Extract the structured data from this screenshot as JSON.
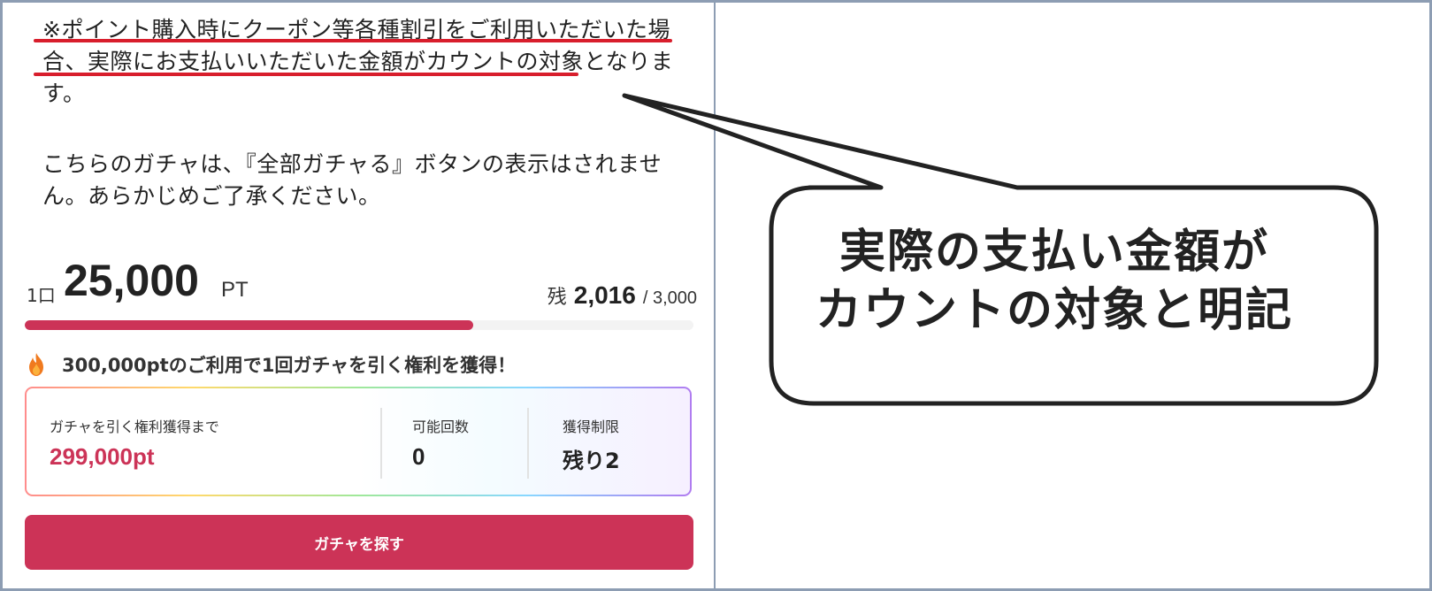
{
  "notice": {
    "line1": "※ポイント購入時にクーポン等各種割引をご利用いただいた場",
    "line2": "合、実際にお支払いいただいた金額がカウントの対象となりま",
    "line3": "す。",
    "line4": "こちらのガチャは、『全部ガチャる』ボタンの表示はされませ",
    "line5": "ん。あらかじめご了承ください。"
  },
  "price": {
    "unit_label": "1口",
    "amount": "25,000",
    "currency": "PT"
  },
  "remaining": {
    "label": "残",
    "count": "2,016",
    "total": "/ 3,000",
    "progress_fraction": 0.67
  },
  "right_banner": {
    "icon": "flame-icon",
    "text": "300,000ptのご利用で1回ガチャを引く権利を獲得！"
  },
  "stats": {
    "until_right_label": "ガチャを引く権利獲得まで",
    "until_right_value": "299,000pt",
    "possible_count_label": "可能回数",
    "possible_count_value": "0",
    "acquire_limit_label": "獲得制限",
    "acquire_limit_value": "残り2"
  },
  "cta": {
    "label": "ガチャを探す"
  },
  "callout": {
    "line1": "実際の支払い金額が",
    "line2": "カウントの対象と明記"
  },
  "colors": {
    "accent": "#cc3357",
    "highlight_underline": "#d81e2c",
    "frame_border": "#8d9db3"
  }
}
